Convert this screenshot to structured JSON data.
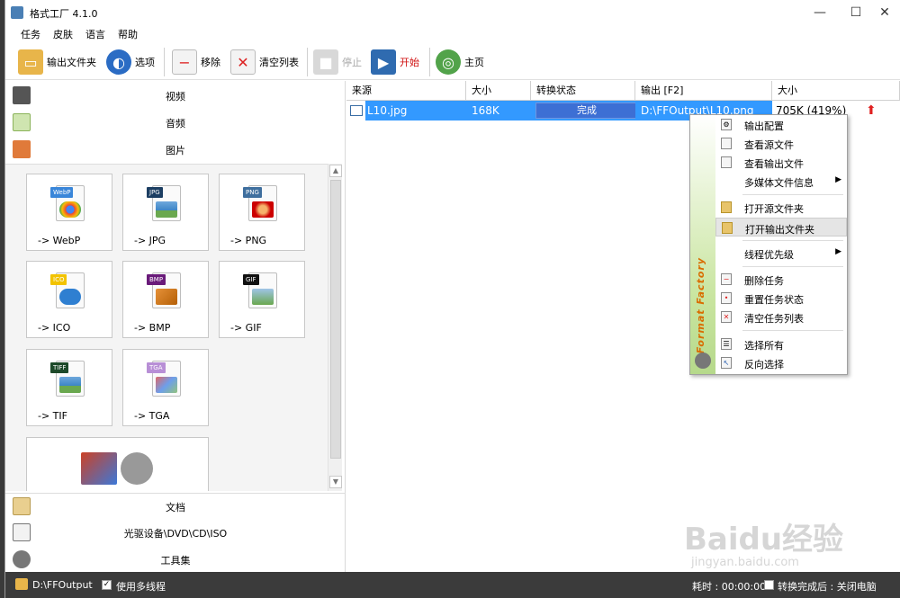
{
  "window": {
    "title": "格式工厂 4.1.0",
    "minimize": "—",
    "maximize": "☐",
    "close": "✕"
  },
  "menu": [
    "任务",
    "皮肤",
    "语言",
    "帮助"
  ],
  "toolbar": {
    "output_folder": "输出文件夹",
    "options": "选项",
    "remove": "移除",
    "clear_list": "清空列表",
    "stop": "停止",
    "start": "开始",
    "home": "主页"
  },
  "categories": {
    "video": "视频",
    "audio": "音频",
    "picture": "图片",
    "document": "文档",
    "optical": "光驱设备\\DVD\\CD\\ISO",
    "tools": "工具集"
  },
  "formats": [
    {
      "label": "-> WebP",
      "badge": "WebP",
      "badge_color": "#3a86d9"
    },
    {
      "label": "-> JPG",
      "badge": "JPG",
      "badge_color": "#1c3e62"
    },
    {
      "label": "-> PNG",
      "badge": "PNG",
      "badge_color": "#3f6f9e"
    },
    {
      "label": "-> ICO",
      "badge": "ICO",
      "badge_color": "#f2c300"
    },
    {
      "label": "-> BMP",
      "badge": "BMP",
      "badge_color": "#6a1b7a"
    },
    {
      "label": "-> GIF",
      "badge": "GIF",
      "badge_color": "#111111"
    },
    {
      "label": "-> TIF",
      "badge": "TIFF",
      "badge_color": "#1d4a2a"
    },
    {
      "label": "-> TGA",
      "badge": "TGA",
      "badge_color": "#b88fd6"
    }
  ],
  "table": {
    "headers": [
      "来源",
      "大小",
      "转换状态",
      "输出 [F2]",
      "大小"
    ],
    "row": {
      "source": "L10.jpg",
      "size": "168K",
      "status": "完成",
      "output": "D:\\FFOutput\\L10.png",
      "out_size": "705K  (419%)"
    }
  },
  "context_menu": {
    "brand": "Format Factory",
    "items": [
      "输出配置",
      "查看源文件",
      "查看输出文件",
      "多媒体文件信息",
      "打开源文件夹",
      "打开输出文件夹",
      "线程优先级",
      "删除任务",
      "重置任务状态",
      "清空任务列表",
      "选择所有",
      "反向选择"
    ]
  },
  "statusbar": {
    "output_path": "D:\\FFOutput",
    "multithread": "使用多线程",
    "elapsed": "耗时 : 00:00:00",
    "after_done": "转换完成后 : 关闭电脑"
  },
  "watermark": {
    "line1": "Baidu经验",
    "line2": "jingyan.baidu.com"
  },
  "colors": {
    "selection": "#3399ff",
    "status_bar": "#3b3b3b",
    "accent_red": "#e02020"
  }
}
